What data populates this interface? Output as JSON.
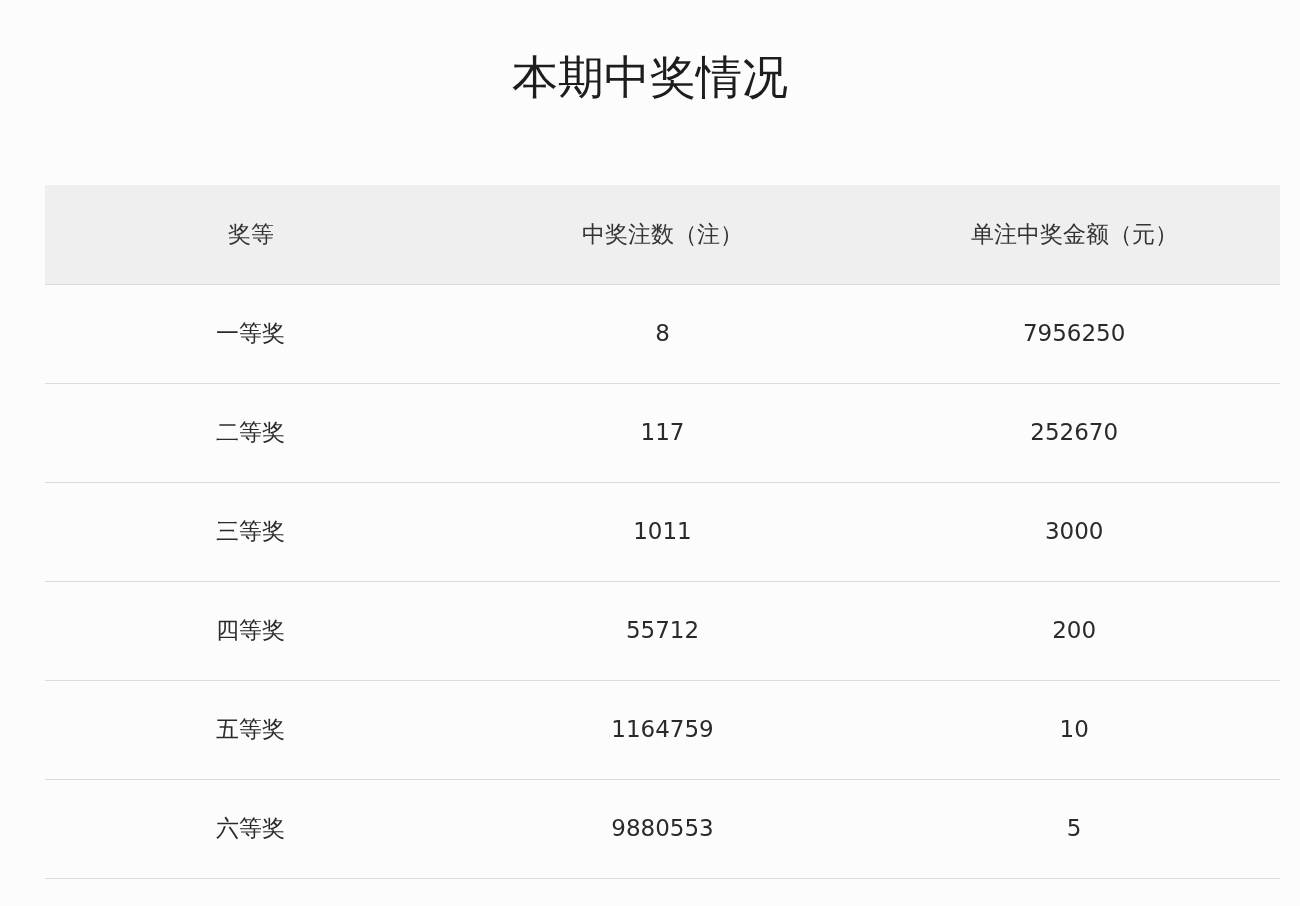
{
  "title": "本期中奖情况",
  "table": {
    "columns": [
      "奖等",
      "中奖注数（注）",
      "单注中奖金额（元）"
    ],
    "rows": [
      [
        "一等奖",
        "8",
        "7956250"
      ],
      [
        "二等奖",
        "117",
        "252670"
      ],
      [
        "三等奖",
        "1011",
        "3000"
      ],
      [
        "四等奖",
        "55712",
        "200"
      ],
      [
        "五等奖",
        "1164759",
        "10"
      ],
      [
        "六等奖",
        "9880553",
        "5"
      ]
    ]
  }
}
